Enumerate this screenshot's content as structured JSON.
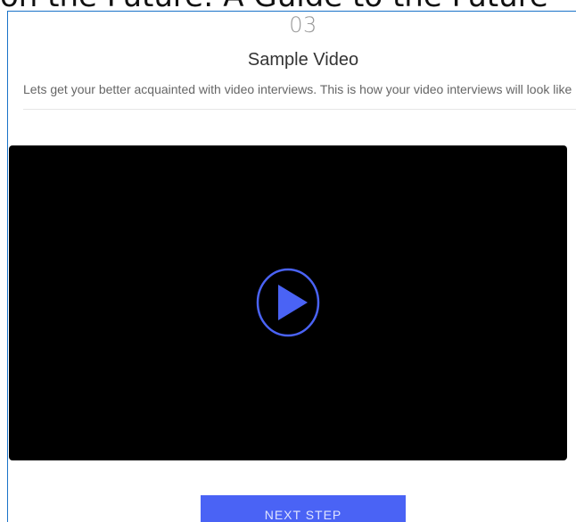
{
  "header": {
    "cut_off_heading": "on the Future: A Guide to the Future"
  },
  "step": {
    "number": "03",
    "title": "Sample Video",
    "description": "Lets get your better acquainted with video interviews. This is how your video interviews will look like"
  },
  "video": {
    "play_icon": "play-icon",
    "accent_color": "#4a63f5"
  },
  "actions": {
    "next_label": "NEXT STEP",
    "next_color": "#4a63f5"
  }
}
